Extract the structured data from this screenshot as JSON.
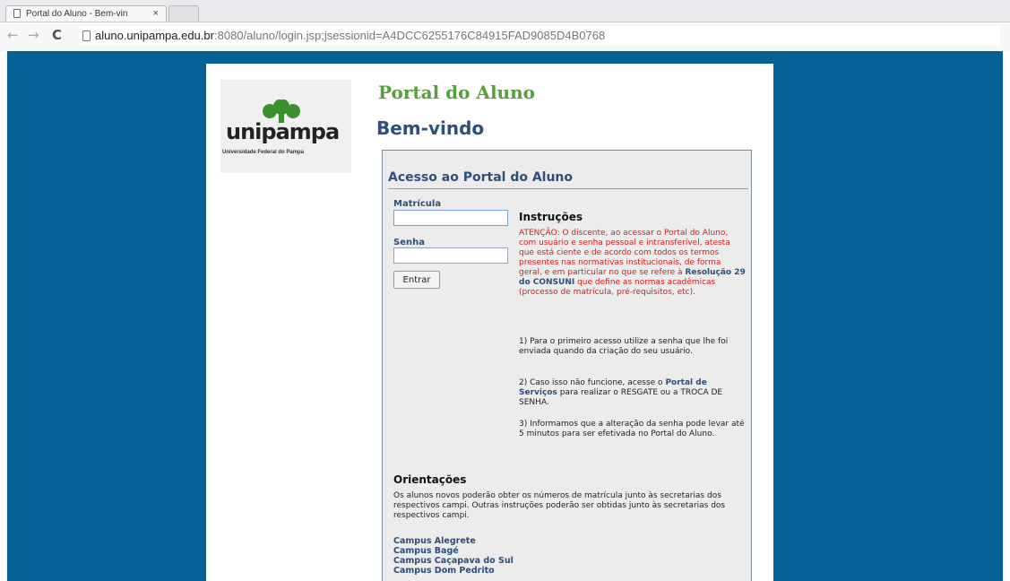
{
  "browser": {
    "tab_title": "Portal do Aluno - Bem-vin",
    "tab_close": "×",
    "url_host": "aluno.unipampa.edu.br",
    "url_path": ":8080/aluno/login.jsp;jsessionid=A4DCC6255176C84915FAD9085D4B0768",
    "back_glyph": "←",
    "forward_glyph": "→",
    "reload_glyph": "C"
  },
  "logo": {
    "name": "unipampa",
    "subtitle": "Universidade Federal do Pampa",
    "tree_color": "#3c8f2f"
  },
  "header": {
    "portal_title": "Portal do Aluno",
    "welcome": "Bem-vindo"
  },
  "login": {
    "title": "Acesso ao Portal do Aluno",
    "matricula_label": "Matrícula",
    "matricula_value": "",
    "senha_label": "Senha",
    "senha_value": "",
    "submit_label": "Entrar"
  },
  "instructions": {
    "title": "Instruções",
    "attention_prefix": "ATENÇÃO: O discente, ao acessar o Portal do Aluno, com usuário e senha pessoal e intransferível, atesta que está ciente e de acordo com todos os termos presentes nas normativas institucionais, de forma geral, e em particular no que se refere à",
    "attention_link": "Resolução 29 do CONSUNI",
    "attention_suffix": "que define as normas acadêmicas (processo de matrícula, pré-requisitos, etc).",
    "item1": "1) Para o primeiro acesso utilize a senha que lhe foi enviada quando da criação do seu usuário.",
    "item2_prefix": "2) Caso isso não funcione, acesse o",
    "item2_link": "Portal de Serviços",
    "item2_suffix": "para realizar o RESGATE ou a TROCA DE SENHA.",
    "item3": "3) Informamos que a alteração da senha pode levar até 5 minutos para ser efetivada no Portal do Aluno."
  },
  "orientations": {
    "title": "Orientações",
    "text": "Os alunos novos poderão obter os números de matrícula junto às secretarias dos respectivos campi. Outras instruções poderão ser obtidas junto às secretarias dos respectivos campi.",
    "campi": [
      "Campus Alegrete",
      "Campus Bagé",
      "Campus Caçapava do Sul",
      "Campus Dom Pedrito"
    ]
  },
  "colors": {
    "page_background": "#036196",
    "heading_blue": "#2c4f7c",
    "portal_green": "#559f3d",
    "attention_red": "#cf2020"
  }
}
